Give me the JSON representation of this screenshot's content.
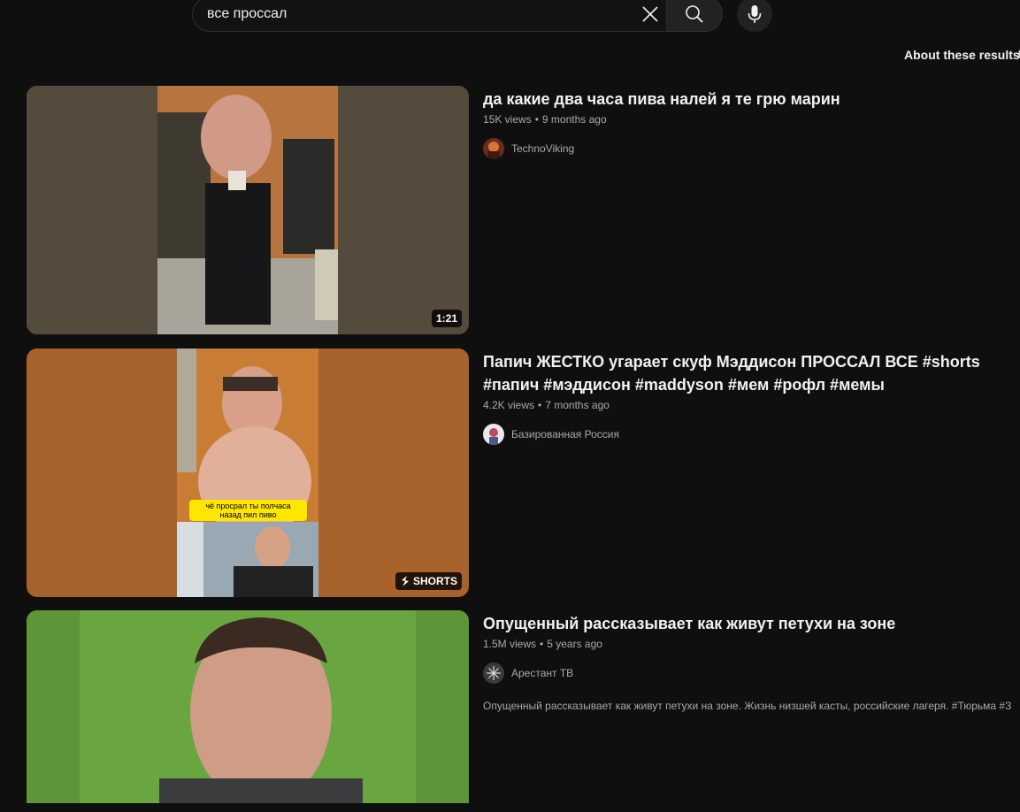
{
  "search": {
    "query": "все проссал"
  },
  "about_results": "About these results",
  "results": [
    {
      "title": "да какие два часа пива налей я те грю марин",
      "views": "15K views",
      "age": "9 months ago",
      "channel": "TechnoViking",
      "badge": "1:21"
    },
    {
      "title": "Папич ЖЕСТКО угарает скуф Мэддисон ПРОССАЛ ВСЕ #shorts #папич #мэддисон #maddyson #мем #рофл #мемы",
      "views": "4.2K views",
      "age": "7 months ago",
      "channel": "Базированная Россия",
      "badge": "SHORTS",
      "caption_line1": "чё просрал ты полчаса",
      "caption_line2": "назад пил пиво"
    },
    {
      "title": "Опущенный рассказывает как живут петухи на зоне",
      "views": "1.5M views",
      "age": "5 years ago",
      "channel": "Арестант ТВ",
      "snippet": "Опущенный рассказывает как живут петухи на зоне. Жизнь низшей касты, российские лагеря. #Тюрьма #З"
    }
  ],
  "colors": {
    "background": "#0f0f0f",
    "text_primary": "#f1f1f1",
    "text_secondary": "#aaaaaa",
    "caption_yellow": "#ffe600"
  },
  "icons": [
    "close-icon",
    "search-icon",
    "mic-icon",
    "info-icon",
    "shorts-icon"
  ]
}
